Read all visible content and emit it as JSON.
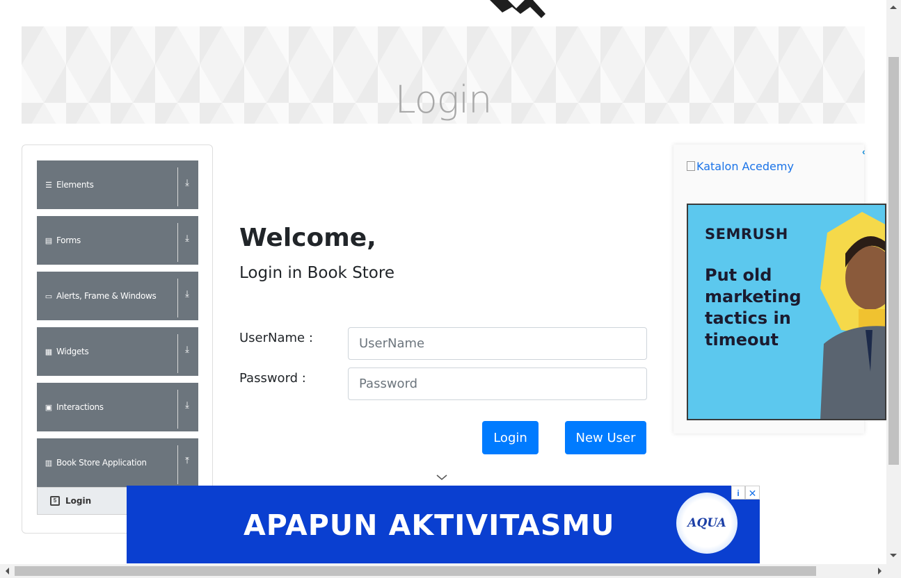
{
  "banner": {
    "title": "Login"
  },
  "sidebar": {
    "groups": [
      {
        "label": "Elements",
        "icon": "menu-icon",
        "arrow": "download-arrow-icon"
      },
      {
        "label": "Forms",
        "icon": "document-icon",
        "arrow": "download-arrow-icon"
      },
      {
        "label": "Alerts, Frame & Windows",
        "icon": "window-icon",
        "arrow": "download-arrow-icon"
      },
      {
        "label": "Widgets",
        "icon": "grid-icon",
        "arrow": "download-arrow-icon"
      },
      {
        "label": "Interactions",
        "icon": "list-icon",
        "arrow": "download-arrow-icon"
      },
      {
        "label": "Book Store Application",
        "icon": "books-icon",
        "arrow": "upload-arrow-icon"
      }
    ],
    "active_item": {
      "label": "Login",
      "icon": "html5-icon"
    }
  },
  "main": {
    "welcome": "Welcome,",
    "subtitle": "Login in Book Store",
    "username_label": "UserName :",
    "username_placeholder": "UserName",
    "password_label": "Password :",
    "password_placeholder": "Password",
    "login_button": "Login",
    "new_user_button": "New User"
  },
  "ad_right": {
    "alt_text": "Katalon Acedemy",
    "brand": "SEMRUSH",
    "headline": "Put old marketing tactics in timeout"
  },
  "ad_bottom": {
    "text": "APAPUN AKTIVITASMU",
    "logo_text": "AQUA"
  },
  "colors": {
    "primary": "#007bff",
    "sidebar_group": "#6c757d",
    "ad_bottom_bg": "#0a3fd0",
    "ad_right_bg": "#5cc8ee"
  }
}
